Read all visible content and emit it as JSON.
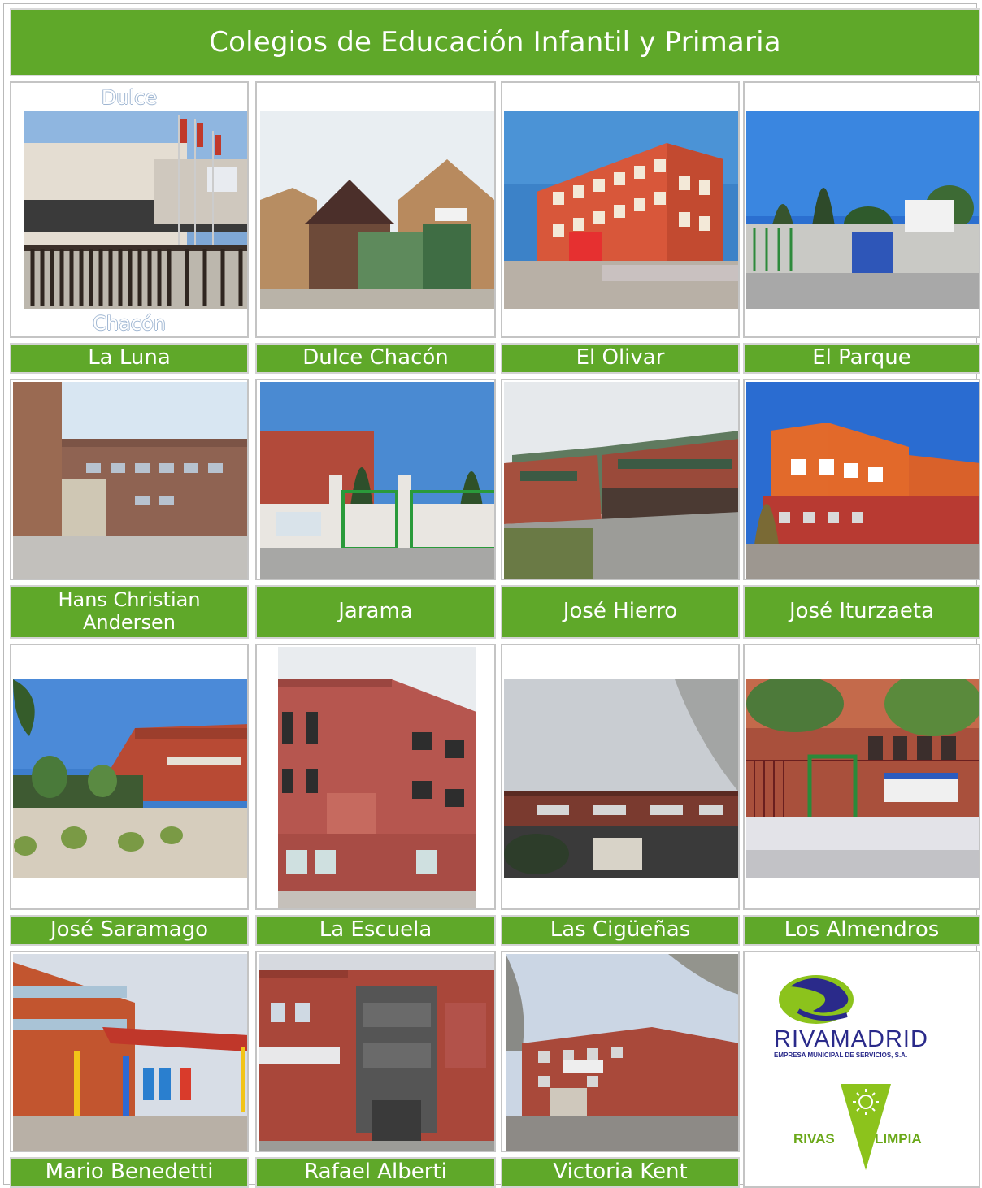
{
  "page_title": "Colegios de Educación Infantil y Primaria",
  "alt_text": {
    "dulce": "Dulce",
    "chacon": "Chacón"
  },
  "schools": [
    {
      "name": "La Luna"
    },
    {
      "name": "Dulce Chacón"
    },
    {
      "name": "El Olivar"
    },
    {
      "name": "El Parque"
    },
    {
      "name": "Hans Christian Andersen"
    },
    {
      "name": "Jarama"
    },
    {
      "name": "José Hierro"
    },
    {
      "name": "José Iturzaeta"
    },
    {
      "name": "José Saramago"
    },
    {
      "name": "La Escuela"
    },
    {
      "name": "Las Cigüeñas"
    },
    {
      "name": "Los Almendros"
    },
    {
      "name": "Mario Benedetti"
    },
    {
      "name": "Rafael Alberti"
    },
    {
      "name": "Victoria Kent"
    }
  ],
  "logos": {
    "rivamadrid": {
      "name": "RIVAMADRID",
      "tagline": "EMPRESA MUNICIPAL DE SERVICIOS, S.A."
    },
    "rivas_limpia": {
      "left": "RIVAS",
      "right": "LIMPIA"
    }
  },
  "colors": {
    "accent_green": "#5fa829",
    "border": "#c4c4c4",
    "brand_blue": "#2a2a8a",
    "brand_lime": "#8cc31c"
  }
}
